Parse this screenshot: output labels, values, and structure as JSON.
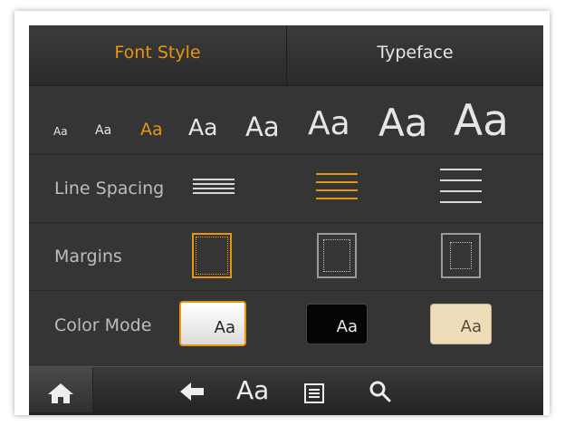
{
  "tabs": [
    {
      "label": "Font Style",
      "active": true
    },
    {
      "label": "Typeface",
      "active": false
    }
  ],
  "font_sizes": {
    "sample": "Aa",
    "count": 8,
    "selected_index": 2
  },
  "line_spacing": {
    "label": "Line Spacing",
    "options": [
      "tight",
      "medium",
      "wide"
    ],
    "selected_index": 1
  },
  "margins": {
    "label": "Margins",
    "options": [
      "narrow",
      "medium",
      "wide"
    ],
    "selected_index": 0
  },
  "color_mode": {
    "label": "Color Mode",
    "sample": "Aa",
    "options": [
      "white",
      "black",
      "sepia"
    ],
    "selected_index": 0
  },
  "toolbar": {
    "home_icon": "home-icon",
    "back_icon": "back-arrow-icon",
    "font_label": "Aa",
    "notes_icon": "notes-icon",
    "search_icon": "search-icon"
  },
  "colors": {
    "accent": "#e8960f",
    "text": "#e6e6e6",
    "muted": "#bdbdbd",
    "panel": "#353535",
    "sepia": "#efdcb8"
  }
}
